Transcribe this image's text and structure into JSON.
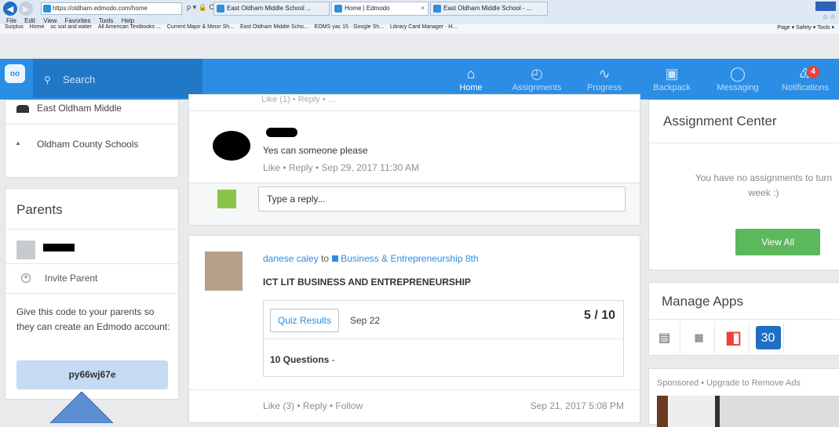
{
  "browser": {
    "url": "https://oldham.edmodo.com/home",
    "address_tools": "ρ ▾ 🔒 C",
    "tabs": [
      {
        "label": "East Oldham Middle School ..."
      },
      {
        "label": "Home | Edmodo"
      },
      {
        "label": "East Oldham Middle School - ..."
      }
    ],
    "tab_close": "×",
    "menu": [
      "File",
      "Edit",
      "View",
      "Favorites",
      "Tools",
      "Help"
    ],
    "favorites": [
      "Surplus",
      "Home",
      "oc soil and water",
      "All American Textbooks ...",
      "Current Major & Minor Sh...",
      "East Oldham Middle Scho...",
      "EOMS yac 15 · Google Sh...",
      "Library Card Manager · H..."
    ],
    "command_bar": "Page ▾  Safety ▾  Tools ▾"
  },
  "header": {
    "search_placeholder": "Search",
    "nav": [
      {
        "label": "Home",
        "icon": "home-icon"
      },
      {
        "label": "Assignments",
        "icon": "assignments-icon"
      },
      {
        "label": "Progress",
        "icon": "progress-icon"
      },
      {
        "label": "Backpack",
        "icon": "backpack-icon"
      },
      {
        "label": "Messaging",
        "icon": "messaging-icon"
      },
      {
        "label": "Notifications",
        "icon": "bell-icon"
      }
    ],
    "notification_count": "4"
  },
  "sidebar": {
    "schools": [
      "East Oldham Middle",
      "Oldham County Schools"
    ],
    "parents_title": "Parents",
    "invite_label": "Invite Parent",
    "code_help": "Give this code to your parents so they can create an Edmodo account:",
    "parent_code": "py66wj67e"
  },
  "feed": {
    "post1": {
      "top_faded": "Like (1) • Reply • ...",
      "text": "Yes can someone please",
      "meta": "Like • Reply • Sep 29, 2017 11:30 AM",
      "reply_placeholder": "Type a reply..."
    },
    "post2": {
      "author": "danese caley",
      "to": "to",
      "group": "Business & Entrepreneurship 8th",
      "title": "ICT LIT BUSINESS AND ENTREPRENEURSHIP",
      "quiz_button": "Quiz Results",
      "quiz_date": "Sep 22",
      "score": "5 / 10",
      "questions": "10 Questions",
      "questions_dash": " -",
      "footer": "Like (3)  •  Reply  •  Follow",
      "time": "Sep 21, 2017 5:08 PM"
    }
  },
  "right": {
    "assign_title": "Assignment Center",
    "assign_empty_line1": "You have no assignments to turn",
    "assign_empty_line2": "week :)",
    "view_all": "View All",
    "apps_title": "Manage Apps",
    "app_calendar": "30",
    "sponsored": "Sponsored  •  Upgrade to Remove Ads"
  },
  "colors": {
    "edmodo_blue": "#2b8de4",
    "green": "#5cb85c",
    "badge_red": "#e8443a"
  }
}
